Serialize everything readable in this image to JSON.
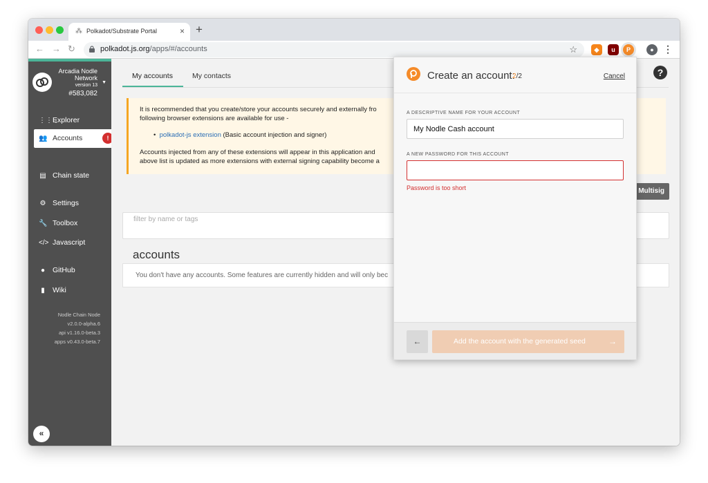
{
  "browser": {
    "tab_title": "Polkadot/Substrate Portal",
    "tab_close": "×",
    "new_tab": "+",
    "url_host": "polkadot.js.org",
    "url_path": "/apps/#/accounts",
    "back": "←",
    "forward": "→",
    "reload": "↻",
    "star": "☆"
  },
  "sidebar": {
    "chain_name": "Arcadia Nodle Network",
    "chain_version": "version 13",
    "block_number": "#583,082",
    "items": [
      {
        "label": "Explorer",
        "icon": "grid-icon"
      },
      {
        "label": "Accounts",
        "icon": "users-icon",
        "badge": "!"
      },
      {
        "label": "Chain state",
        "icon": "database-icon"
      },
      {
        "label": "Settings",
        "icon": "gears-icon"
      },
      {
        "label": "Toolbox",
        "icon": "wrench-icon"
      },
      {
        "label": "Javascript",
        "icon": "code-icon"
      },
      {
        "label": "GitHub",
        "icon": "github-icon"
      },
      {
        "label": "Wiki",
        "icon": "book-icon"
      }
    ],
    "versions": [
      "Nodle Chain Node",
      "v2.0.0-alpha.6",
      "api v1.16.0-beta.3",
      "apps v0.43.0-beta.7"
    ],
    "collapse": "«"
  },
  "main": {
    "tabs": [
      "My accounts",
      "My contacts"
    ],
    "help": "?",
    "warning_line1": "It is recommended that you create/store your accounts securely and externally fro",
    "warning_line2": "following browser extensions are available for use -",
    "warning_link": "polkadot-js extension",
    "warning_link_desc": " (Basic account injection and signer)",
    "warning_line3": "Accounts injected from any of these extensions will appear in this application and",
    "warning_line4": "above list is updated as more extensions with external signing capability become a",
    "multisig_label": "Multisig",
    "filter_placeholder": "filter by name or tags",
    "accounts_heading": "accounts",
    "empty_text": "You don't have any accounts. Some features are currently hidden and will only bec"
  },
  "modal": {
    "title": "Create an account:",
    "step_current": "2",
    "step_total": "/2",
    "cancel": "Cancel",
    "name_label": "A DESCRIPTIVE NAME FOR YOUR ACCOUNT",
    "name_value": "My Nodle Cash account",
    "password_label": "A NEW PASSWORD FOR THIS ACCOUNT",
    "password_value": "",
    "password_error": "Password is too short",
    "back_button": "←",
    "create_button": "Add the account with the generated seed",
    "create_arrow": "→"
  },
  "colors": {
    "sidebar_bg": "#4f4f4f",
    "accent_teal": "#4bb598",
    "polkadot_orange": "#f58b29",
    "error_red": "#d32f2f",
    "warning_border": "#f5a623"
  }
}
